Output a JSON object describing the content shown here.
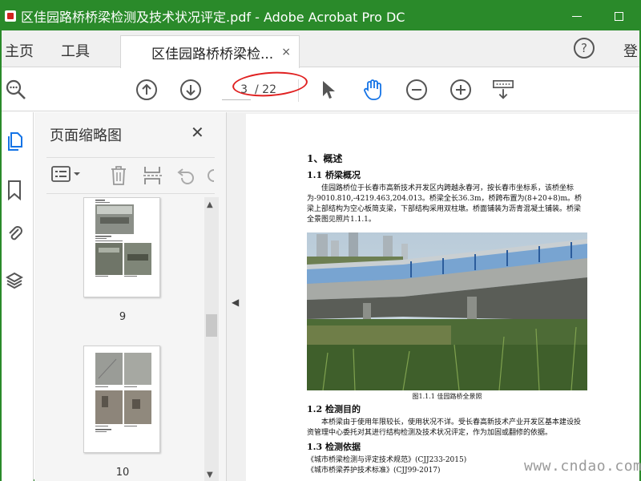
{
  "window": {
    "title": "区佳园路桥桥梁检测及技术状况评定.pdf - Adobe Acrobat Pro DC",
    "minimize_label": "",
    "maximize_label": ""
  },
  "tabs": {
    "home": "主页",
    "tools": "工具",
    "document": "区佳园路桥桥梁检...",
    "close": "×",
    "help": "?",
    "login": "登"
  },
  "toolbar": {
    "current_page": "3",
    "total_pages": "/ 22"
  },
  "panel": {
    "title": "页面缩略图",
    "close": "✕",
    "thumbnails": [
      {
        "page": "9"
      },
      {
        "page": "10"
      }
    ]
  },
  "document": {
    "section1_heading": "1、概述",
    "sub11_heading": "1.1  桥梁概况",
    "para1": "佳园路桥位于长春市高新技术开发区内跨越永春河，按长春市坐标系，该桥坐标为-9010.810,-4219.463,204.013。桥梁全长36.3m，桥跨布置为(8+20+8)m。桥梁上部结构为空心板简支梁，下部结构采用双柱墩。桥面铺装为沥青混凝土铺装。桥梁全景图见照片1.1.1。",
    "figure_caption": "图1.1.1  佳园路桥全景照",
    "sub12_heading": "1.2  检测目的",
    "para2": "本桥梁由于使用年限较长，使用状况不详。受长春高新技术产业开发区基本建设投资管理中心委托对其进行结构检测及技术状况评定，作为加固或翻修的依据。",
    "sub13_heading": "1.3  检测依据",
    "ref1": "《城市桥梁检测与评定技术规范》(CJJ233-2015)",
    "ref2": "《城市桥梁养护技术标准》(CJJ99-2017)"
  },
  "watermark": "www.cndao.com"
}
